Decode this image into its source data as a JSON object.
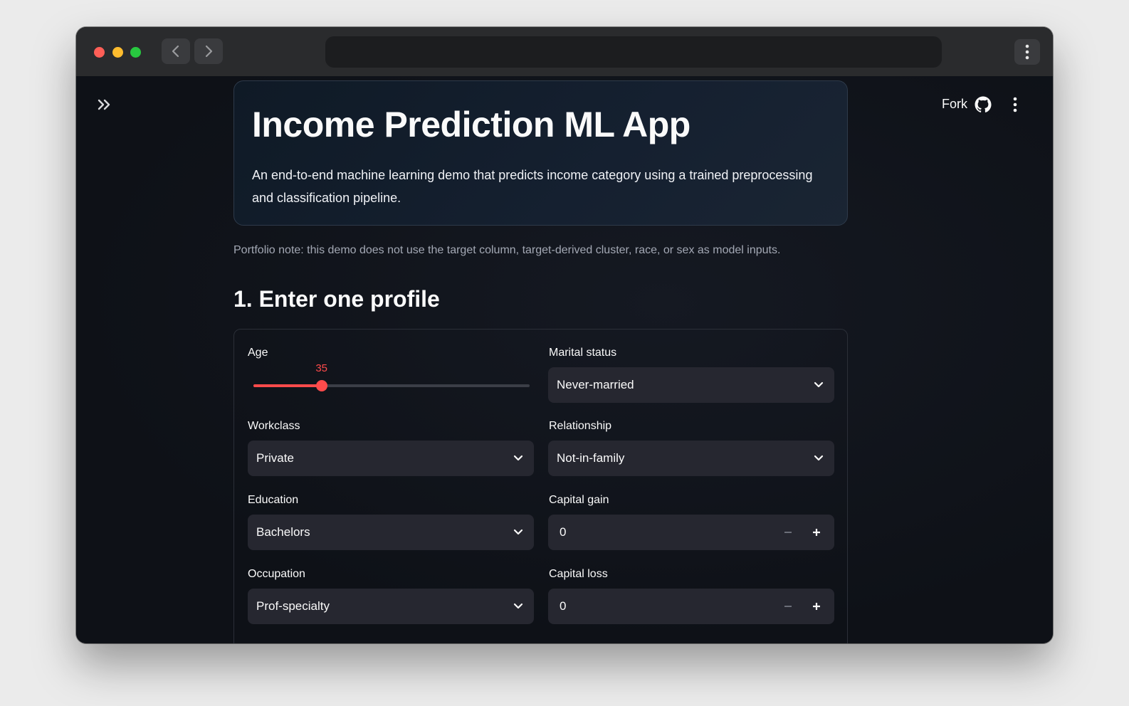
{
  "header": {
    "fork_label": "Fork"
  },
  "hero": {
    "title": "Income Prediction ML App",
    "description": "An end-to-end machine learning demo that predicts income category using a trained preprocessing and classification pipeline."
  },
  "note": "Portfolio note: this demo does not use the target column, target-derived cluster, race, or sex as model inputs.",
  "section": {
    "title": "1. Enter one profile"
  },
  "form": {
    "age": {
      "label": "Age",
      "value": 35,
      "value_text": "35",
      "min": 17,
      "max": 90
    },
    "marital_status": {
      "label": "Marital status",
      "value": "Never-married"
    },
    "workclass": {
      "label": "Workclass",
      "value": "Private"
    },
    "relationship": {
      "label": "Relationship",
      "value": "Not-in-family"
    },
    "education": {
      "label": "Education",
      "value": "Bachelors"
    },
    "capital_gain": {
      "label": "Capital gain",
      "value": "0"
    },
    "occupation": {
      "label": "Occupation",
      "value": "Prof-specialty"
    },
    "capital_loss": {
      "label": "Capital loss",
      "value": "0"
    }
  },
  "colors": {
    "accent": "#ff4b4b",
    "background": "#0e1117",
    "input_bg": "#262730"
  },
  "icons": {
    "sidebar_toggle": "double-chevron-right-icon",
    "github": "github-icon",
    "menu": "kebab-menu-icon",
    "dropdown": "chevron-down-icon"
  }
}
